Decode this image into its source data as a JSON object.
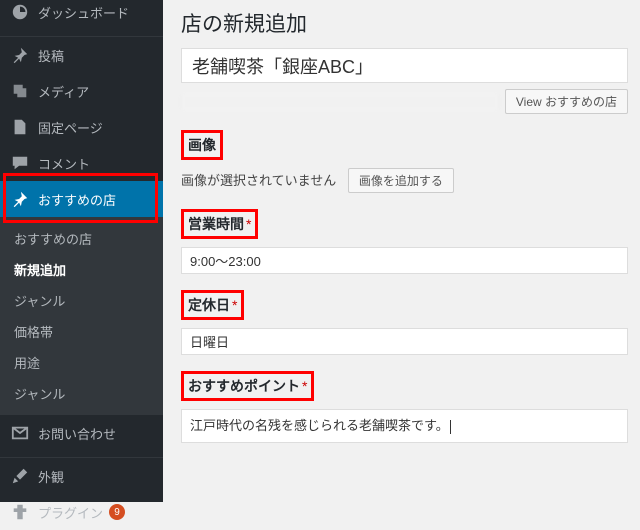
{
  "sidebar": {
    "dashboard": "ダッシュボード",
    "posts": "投稿",
    "media": "メディア",
    "pages": "固定ページ",
    "comments": "コメント",
    "recommended": "おすすめの店",
    "sub": {
      "list": "おすすめの店",
      "add": "新規追加",
      "genre": "ジャンル",
      "price": "価格帯",
      "purpose": "用途",
      "genre2": "ジャンル"
    },
    "contact": "お問い合わせ",
    "appearance": "外観",
    "plugins": "プラグイン",
    "plugins_badge": "9"
  },
  "page": {
    "heading": "店の新規追加",
    "title_value": "老舗喫茶「銀座ABC」",
    "view_button": "View おすすめの店"
  },
  "fields": {
    "image": {
      "label": "画像",
      "no_image": "画像が選択されていません",
      "button": "画像を追加する"
    },
    "hours": {
      "label": "営業時間",
      "value": "9:00～23:00"
    },
    "closed": {
      "label": "定休日",
      "value": "日曜日"
    },
    "point": {
      "label": "おすすめポイント",
      "value": "江戸時代の名残を感じられる老舗喫茶です。"
    }
  }
}
